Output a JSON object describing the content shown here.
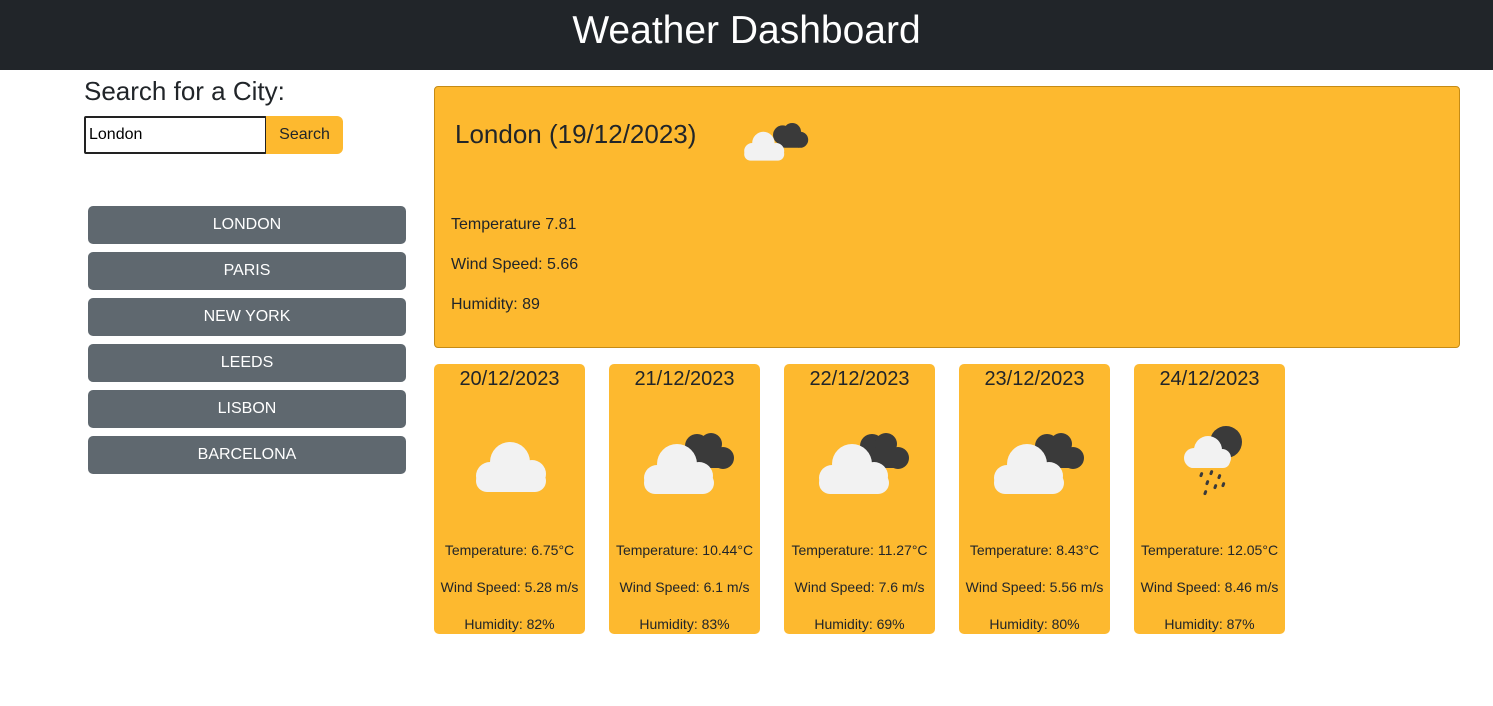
{
  "header": {
    "title": "Weather Dashboard"
  },
  "search": {
    "title": "Search for a City:",
    "value": "London",
    "button_label": "Search"
  },
  "history": [
    {
      "label": "London"
    },
    {
      "label": "Paris"
    },
    {
      "label": "New York"
    },
    {
      "label": "Leeds"
    },
    {
      "label": "Lisbon"
    },
    {
      "label": "Barcelona"
    }
  ],
  "today": {
    "title": "London (19/12/2023)",
    "icon": "broken-clouds-icon",
    "temperature": "Temperature 7.81",
    "wind": "Wind Speed: 5.66",
    "humidity": "Humidity: 89"
  },
  "forecast": [
    {
      "date": "20/12/2023",
      "icon": "cloud-icon",
      "temperature": "Temperature: 6.75°C",
      "wind": "Wind Speed: 5.28 m/s",
      "humidity": "Humidity: 82%"
    },
    {
      "date": "21/12/2023",
      "icon": "broken-clouds-icon",
      "temperature": "Temperature: 10.44°C",
      "wind": "Wind Speed: 6.1 m/s",
      "humidity": "Humidity: 83%"
    },
    {
      "date": "22/12/2023",
      "icon": "broken-clouds-icon",
      "temperature": "Temperature: 11.27°C",
      "wind": "Wind Speed: 7.6 m/s",
      "humidity": "Humidity: 69%"
    },
    {
      "date": "23/12/2023",
      "icon": "broken-clouds-icon",
      "temperature": "Temperature: 8.43°C",
      "wind": "Wind Speed: 5.56 m/s",
      "humidity": "Humidity: 80%"
    },
    {
      "date": "24/12/2023",
      "icon": "rain-cloud-icon",
      "temperature": "Temperature: 12.05°C",
      "wind": "Wind Speed: 8.46 m/s",
      "humidity": "Humidity: 87%"
    }
  ],
  "colors": {
    "header_bg": "#212529",
    "accent": "#fdb92f",
    "history_button": "#5f686f"
  }
}
